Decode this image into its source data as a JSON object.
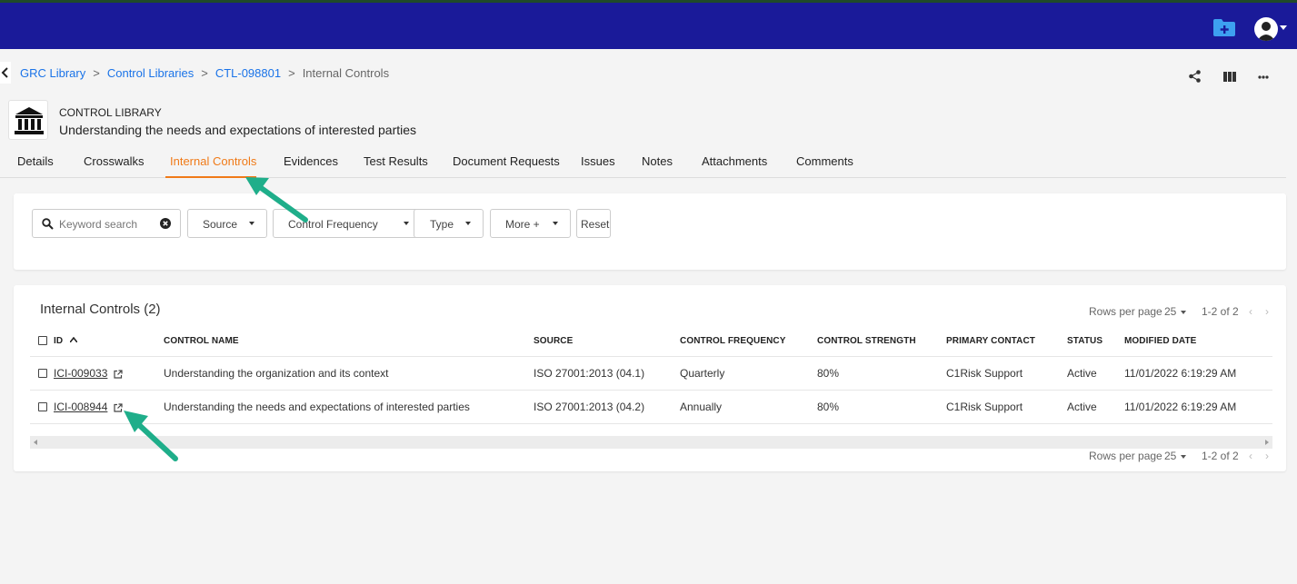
{
  "breadcrumb": {
    "items": [
      "GRC Library",
      "Control Libraries",
      "CTL-098801"
    ],
    "current": "Internal Controls",
    "separator": ">"
  },
  "header_icons": [
    "share-icon",
    "columns-icon",
    "more-icon"
  ],
  "library": {
    "kicker": "CONTROL LIBRARY",
    "title": "Understanding the needs and expectations of interested parties",
    "icon": "bank-building-icon"
  },
  "tabs": [
    {
      "label": "Details"
    },
    {
      "label": "Crosswalks"
    },
    {
      "label": "Internal Controls",
      "active": true
    },
    {
      "label": "Evidences"
    },
    {
      "label": "Test Results"
    },
    {
      "label": "Document Requests"
    },
    {
      "label": "Issues"
    },
    {
      "label": "Notes"
    },
    {
      "label": "Attachments"
    },
    {
      "label": "Comments"
    }
  ],
  "filters": {
    "search_placeholder": "Keyword search",
    "dropdowns": [
      "Source",
      "Control Frequency",
      "Type",
      "More +"
    ],
    "reset_label": "Reset"
  },
  "table": {
    "title": "Internal Controls (2)",
    "pager": {
      "rows_label": "Rows per page",
      "rows_value": "25",
      "range": "1-2 of 2"
    },
    "columns": [
      "ID",
      "CONTROL NAME",
      "SOURCE",
      "CONTROL FREQUENCY",
      "CONTROL STRENGTH",
      "PRIMARY CONTACT",
      "STATUS",
      "MODIFIED DATE"
    ],
    "rows": [
      [
        "ICI-009033",
        "Understanding the organization and its context",
        "ISO 27001:2013 (04.1)",
        "Quarterly",
        "80%",
        "C1Risk Support",
        "Active",
        "11/01/2022 6:19:29 AM"
      ],
      [
        "ICI-008944",
        "Understanding the needs and expectations of interested parties",
        "ISO 27001:2013 (04.2)",
        "Annually",
        "80%",
        "C1Risk Support",
        "Active",
        "11/01/2022 6:19:29 AM"
      ]
    ]
  },
  "colors": {
    "topbar": "#1a1a99",
    "link": "#1a73e8",
    "active_tab": "#f07a18",
    "annotation_arrow": "#1fae8a"
  }
}
